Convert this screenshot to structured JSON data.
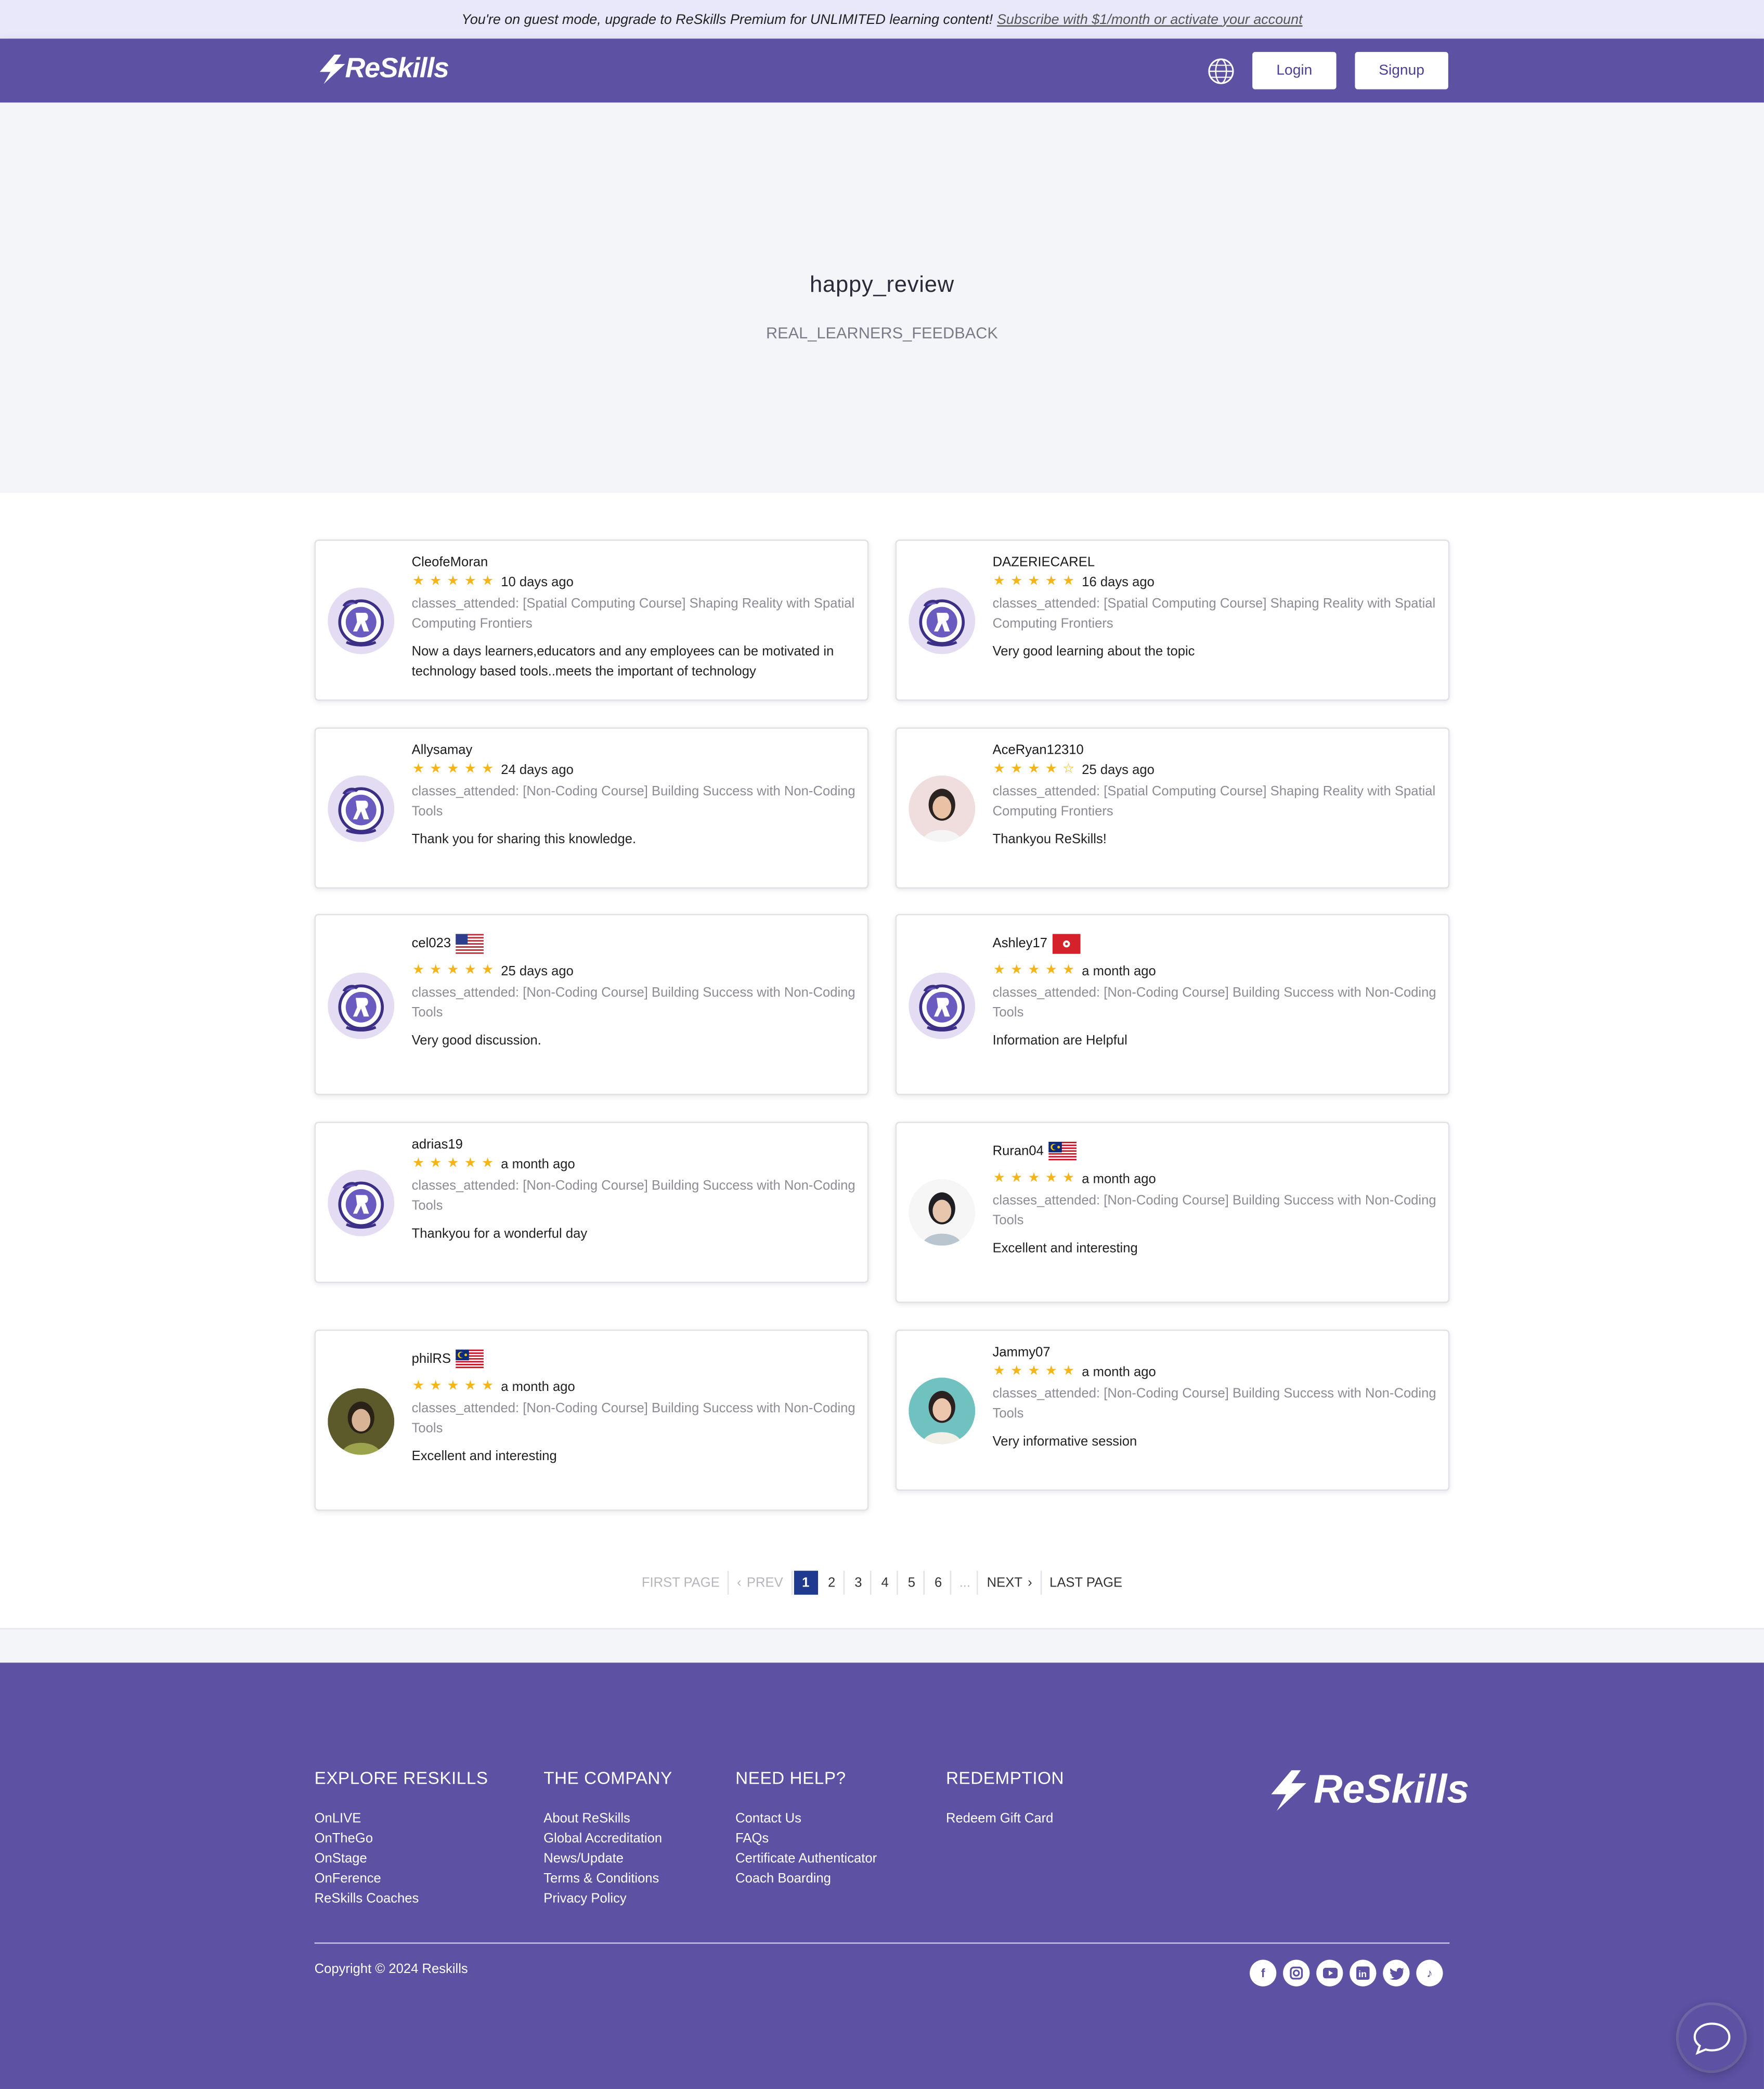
{
  "banner": {
    "text": "You're on guest mode, upgrade to ReSkills Premium for UNLIMITED learning content!",
    "link": "Subscribe with $1/month or activate your account"
  },
  "header": {
    "logo": "ReSkills",
    "login": "Login",
    "signup": "Signup"
  },
  "hero": {
    "title": "happy_review",
    "subtitle": "REAL_LEARNERS_FEEDBACK"
  },
  "reviews": [
    {
      "name": "CleofeMoran",
      "rating": 5,
      "time": "10 days ago",
      "classes": "classes_attended: [Spatial Computing Course] Shaping Reality with Spatial Computing Frontiers",
      "comment": "Now a days learners,educators and any employees can be motivated in technology based tools..meets the important of technology",
      "avatar": "reskills-logo-avatar"
    },
    {
      "name": "DAZERIECAREL",
      "rating": 5,
      "time": "16 days ago",
      "classes": "classes_attended: [Spatial Computing Course] Shaping Reality with Spatial Computing Frontiers",
      "comment": "Very good learning about the topic",
      "avatar": "reskills-logo-avatar"
    },
    {
      "name": "Allysamay",
      "rating": 5,
      "time": "24 days ago",
      "classes": "classes_attended: [Non-Coding Course] Building Success with Non-Coding Tools",
      "comment": "Thank you for sharing this knowledge.",
      "avatar": "reskills-logo-avatar"
    },
    {
      "name": "AceRyan12310",
      "rating": 4,
      "time": "25 days ago",
      "classes": "classes_attended: [Spatial Computing Course] Shaping Reality with Spatial Computing Frontiers",
      "comment": "Thankyou ReSkills!",
      "avatar": "user-photo-avatar"
    },
    {
      "name": "cel023",
      "rating": 5,
      "time": "25 days ago",
      "classes": "classes_attended: [Non-Coding Course] Building Success with Non-Coding Tools",
      "comment": "Very good discussion.",
      "avatar": "reskills-logo-avatar",
      "flag": "us-flag"
    },
    {
      "name": "Ashley17",
      "rating": 5,
      "time": "a month ago",
      "classes": "classes_attended: [Non-Coding Course] Building Success with Non-Coding Tools",
      "comment": "Information are Helpful",
      "avatar": "reskills-logo-avatar",
      "flag": "hk-flag"
    },
    {
      "name": "adrias19",
      "rating": 5,
      "time": "a month ago",
      "classes": "classes_attended: [Non-Coding Course] Building Success with Non-Coding Tools",
      "comment": "Thankyou for a wonderful day",
      "avatar": "reskills-logo-avatar"
    },
    {
      "name": "Ruran04",
      "rating": 5,
      "time": "a month ago",
      "classes": "classes_attended: [Non-Coding Course] Building Success with Non-Coding Tools",
      "comment": "Excellent and interesting",
      "avatar": "user-photo-avatar",
      "flag": "my-flag"
    },
    {
      "name": "philRS",
      "rating": 5,
      "time": "a month ago",
      "classes": "classes_attended: [Non-Coding Course] Building Success with Non-Coding Tools",
      "comment": "Excellent and interesting",
      "avatar": "user-photo-avatar",
      "flag": "my-flag"
    },
    {
      "name": "Jammy07",
      "rating": 5,
      "time": "a month ago",
      "classes": "classes_attended: [Non-Coding Course] Building Success with Non-Coding Tools",
      "comment": "Very informative session",
      "avatar": "user-photo-avatar"
    }
  ],
  "pagination": {
    "first": "FIRST PAGE",
    "prev": "PREV",
    "pages": [
      "1",
      "2",
      "3",
      "4",
      "5",
      "6"
    ],
    "ellipsis": "...",
    "next": "NEXT",
    "last": "LAST PAGE",
    "current": "1"
  },
  "footer": {
    "explore": {
      "title": "EXPLORE RESKILLS",
      "links": [
        "OnLIVE",
        "OnTheGo",
        "OnStage",
        "OnFerence",
        "ReSkills Coaches"
      ]
    },
    "company": {
      "title": "THE COMPANY",
      "links": [
        "About ReSkills",
        "Global Accreditation",
        "News/Update",
        "Terms & Conditions",
        "Privacy Policy"
      ]
    },
    "help": {
      "title": "NEED HELP?",
      "links": [
        "Contact Us",
        "FAQs",
        "Certificate Authenticator",
        "Coach Boarding"
      ]
    },
    "redemption": {
      "title": "REDEMPTION",
      "links": [
        "Redeem Gift Card"
      ]
    },
    "logo": "ReSkills",
    "copyright": "Copyright © 2024 Reskills",
    "social": [
      "facebook-icon",
      "instagram-icon",
      "youtube-icon",
      "linkedin-icon",
      "twitter-icon",
      "tiktok-icon"
    ]
  },
  "colors": {
    "brand": "#5c51a3",
    "banner_bg": "#e9e8fb",
    "star": "#f3b51a",
    "active_page": "#1f3a8f"
  }
}
